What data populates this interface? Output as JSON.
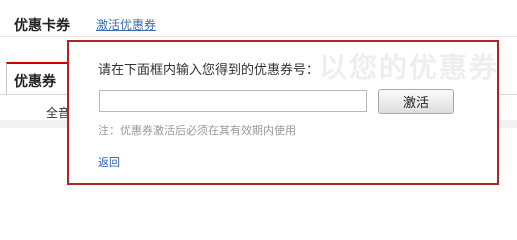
{
  "header": {
    "title": "优惠卡券",
    "activate_link": "激活优惠券"
  },
  "background": {
    "tab_label": "优惠券",
    "sub_label": "全音"
  },
  "dialog": {
    "watermark": "以您的优惠券",
    "prompt": "请在下面框内输入您得到的优惠券号：",
    "input_value": "",
    "input_placeholder": "",
    "activate_button": "激活",
    "note": "注：优惠券激活后必须在其有效期内使用",
    "back_link": "返回"
  },
  "colors": {
    "dialog_border": "#b02424",
    "link": "#2b5fb3"
  }
}
